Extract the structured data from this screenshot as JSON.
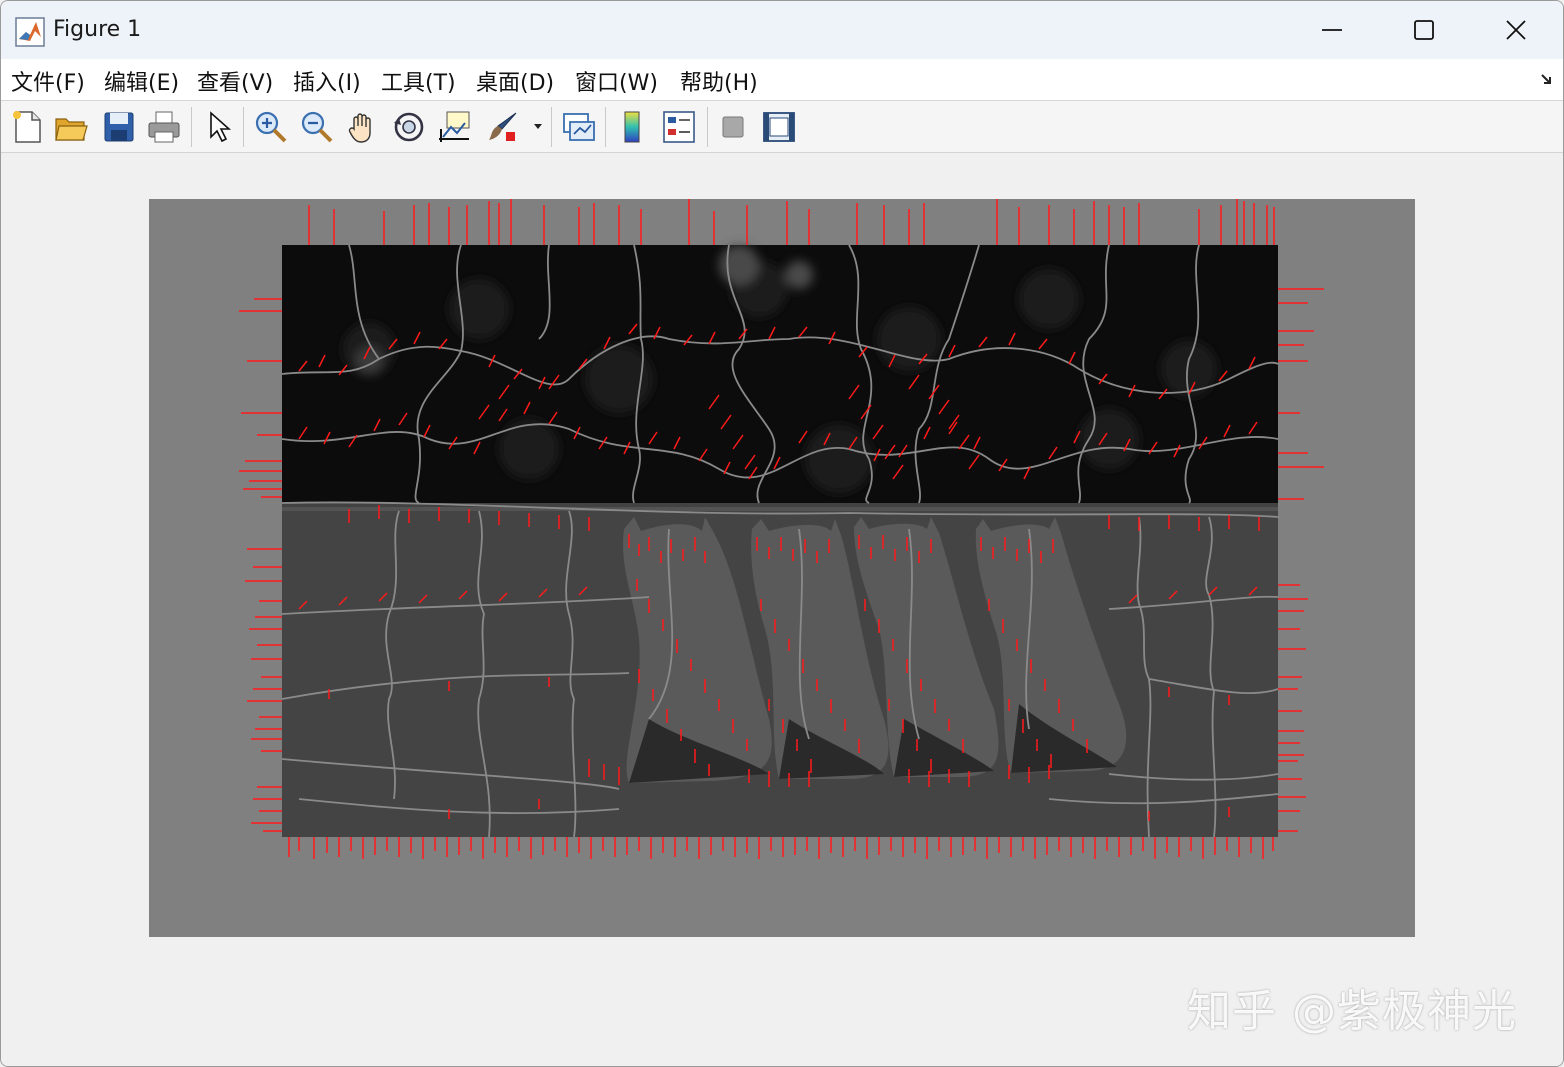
{
  "window": {
    "title": "Figure 1",
    "icon": "matlab-icon",
    "controls": [
      "minimize-icon",
      "maximize-icon",
      "close-icon"
    ]
  },
  "menubar": {
    "items": [
      {
        "label": "文件(F)"
      },
      {
        "label": "编辑(E)"
      },
      {
        "label": "查看(V)"
      },
      {
        "label": "插入(I)"
      },
      {
        "label": "工具(T)"
      },
      {
        "label": "桌面(D)"
      },
      {
        "label": "窗口(W)"
      },
      {
        "label": "帮助(H)"
      }
    ],
    "dock_icon": "dock-arrow-icon"
  },
  "toolbar": {
    "buttons": [
      "new-figure-icon",
      "open-file-icon",
      "save-icon",
      "print-icon",
      "edit-plot-arrow-icon",
      "zoom-in-icon",
      "zoom-out-icon",
      "pan-hand-icon",
      "rotate-3d-icon",
      "data-cursor-icon",
      "brush-icon",
      "brush-dropdown-icon",
      "link-plot-icon",
      "colorbar-icon",
      "legend-icon",
      "hide-plot-tools-icon",
      "show-plot-tools-icon"
    ]
  },
  "figure": {
    "content": "image",
    "colors": {
      "background": "#808080",
      "image_sky": "#0c0c0c",
      "image_ground": "#444444",
      "boundary_lines": "#8a8a8a",
      "gradient_markers": "#ff1a1a"
    }
  },
  "watermark": {
    "text": "知乎 @紫极神光"
  }
}
